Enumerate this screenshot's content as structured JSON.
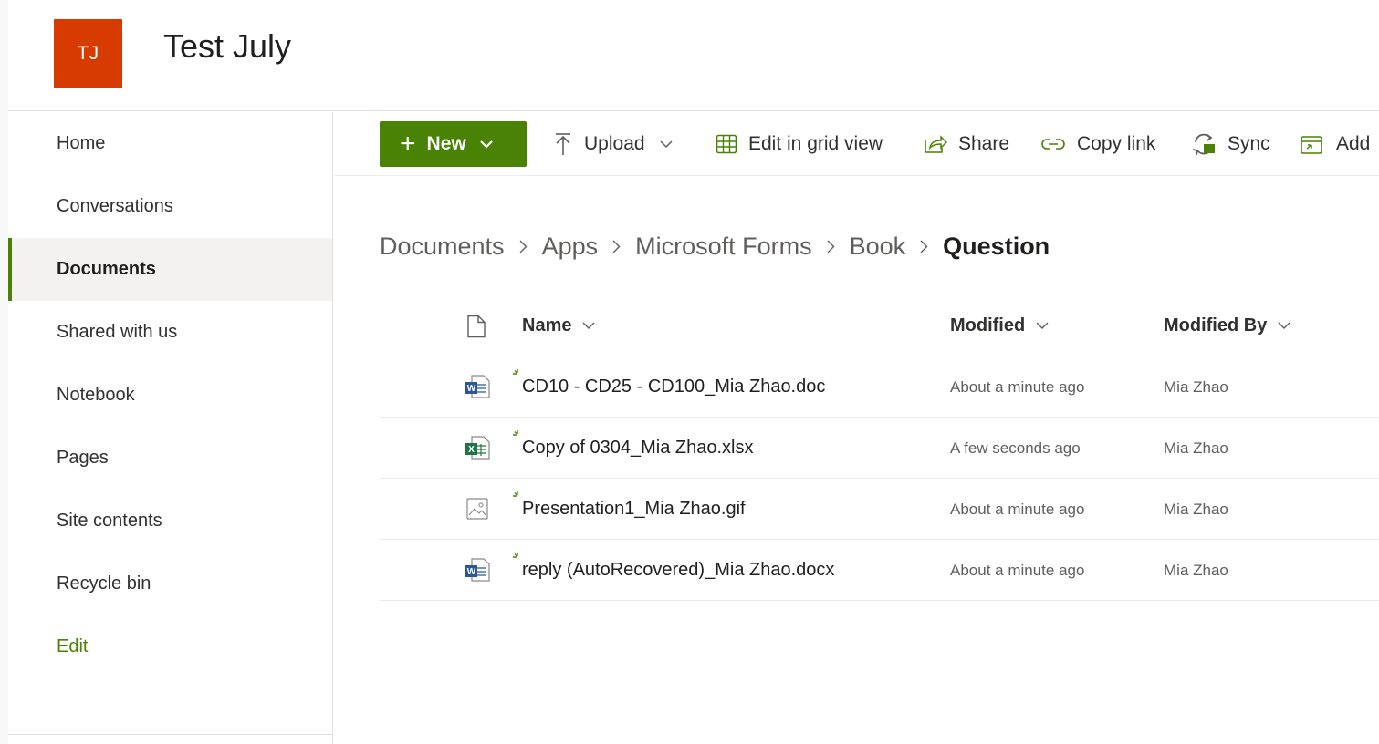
{
  "site": {
    "logo_initials": "TJ",
    "title": "Test July",
    "logo_color": "#d83b01"
  },
  "nav": {
    "items": [
      {
        "label": "Home",
        "icon": "none"
      },
      {
        "label": "Conversations",
        "icon": "none"
      },
      {
        "label": "Documents",
        "icon": "none",
        "selected": true
      },
      {
        "label": "Shared with us",
        "icon": "none"
      },
      {
        "label": "Notebook",
        "icon": "none"
      },
      {
        "label": "Pages",
        "icon": "none"
      },
      {
        "label": "Site contents",
        "icon": "none"
      },
      {
        "label": "Recycle bin",
        "icon": "none"
      }
    ],
    "edit_label": "Edit"
  },
  "commandbar": {
    "new_label": "New",
    "upload_label": "Upload",
    "grid_label": "Edit in grid view",
    "share_label": "Share",
    "copylink_label": "Copy link",
    "sync_label": "Sync",
    "add_label": "Add",
    "accent_color": "#498205"
  },
  "breadcrumb": {
    "items": [
      "Documents",
      "Apps",
      "Microsoft Forms",
      "Book"
    ],
    "current": "Question"
  },
  "list": {
    "columns": {
      "name": "Name",
      "modified": "Modified",
      "modified_by": "Modified By"
    },
    "rows": [
      {
        "name": "CD10 - CD25 - CD100_Mia Zhao.doc",
        "type": "word",
        "modified": "About a minute ago",
        "modified_by": "Mia Zhao"
      },
      {
        "name": "Copy of 0304_Mia Zhao.xlsx",
        "type": "excel",
        "modified": "A few seconds ago",
        "modified_by": "Mia Zhao"
      },
      {
        "name": "Presentation1_Mia Zhao.gif",
        "type": "image",
        "modified": "About a minute ago",
        "modified_by": "Mia Zhao"
      },
      {
        "name": "reply (AutoRecovered)_Mia Zhao.docx",
        "type": "word",
        "modified": "About a minute ago",
        "modified_by": "Mia Zhao"
      }
    ]
  }
}
